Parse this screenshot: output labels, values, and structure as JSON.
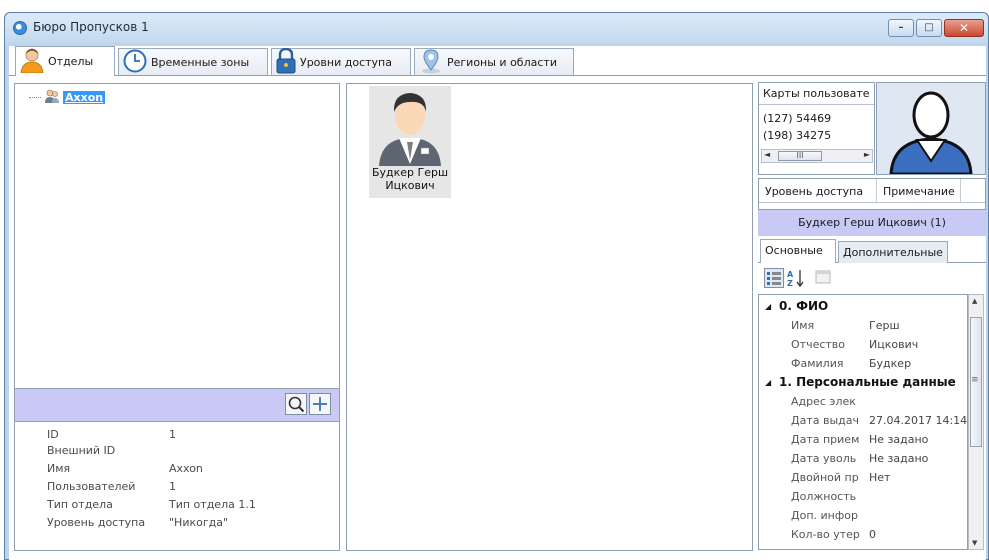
{
  "window": {
    "title": "Бюро Пропусков 1",
    "buttons": {
      "minimize": "–",
      "maximize": "□",
      "close": "✕"
    }
  },
  "tabs": [
    {
      "label": "Отделы",
      "icon": "person-icon",
      "active": true
    },
    {
      "label": "Временные зоны",
      "icon": "clock-icon",
      "active": false
    },
    {
      "label": "Уровни доступа",
      "icon": "lock-icon",
      "active": false
    },
    {
      "label": "Регионы и области",
      "icon": "map-pin-icon",
      "active": false
    }
  ],
  "tree": {
    "root_label": "Axxon"
  },
  "department_props": [
    {
      "key": "ID",
      "value": "1"
    },
    {
      "key": "Внешний ID",
      "value": ""
    },
    {
      "key": "Имя",
      "value": "Axxon"
    },
    {
      "key": "Пользователей",
      "value": "1"
    },
    {
      "key": "Тип отдела",
      "value": "Тип отдела 1.1"
    },
    {
      "key": "Уровень доступа",
      "value": "\"Никогда\""
    }
  ],
  "person_tile": {
    "name_line1": "Будкер Герш",
    "name_line2": "Ицкович"
  },
  "cards": {
    "header": "Карты пользовате",
    "rows": [
      "(127) 54469",
      "(198) 34275"
    ],
    "scroll_label": "III"
  },
  "access_table": {
    "columns": [
      "Уровень доступа",
      "Примечание"
    ]
  },
  "person_header": "Будкер Герш Ицкович (1)",
  "subtabs": [
    {
      "label": "Основные",
      "active": true
    },
    {
      "label": "Дополнительные",
      "active": false
    }
  ],
  "property_grid": [
    {
      "type": "category",
      "label": "0. ФИО"
    },
    {
      "type": "prop",
      "key": "Имя",
      "value": "Герш"
    },
    {
      "type": "prop",
      "key": "Отчество",
      "value": "Ицкович"
    },
    {
      "type": "prop",
      "key": "Фамилия",
      "value": "Будкер"
    },
    {
      "type": "category",
      "label": "1. Персональные данные"
    },
    {
      "type": "prop",
      "key": "Адрес элек",
      "value": ""
    },
    {
      "type": "prop",
      "key": "Дата выдач",
      "value": "27.04.2017 14:14"
    },
    {
      "type": "prop",
      "key": "Дата прием",
      "value": "Не задано"
    },
    {
      "type": "prop",
      "key": "Дата уволь",
      "value": "Не задано"
    },
    {
      "type": "prop",
      "key": "Двойной пр",
      "value": "Нет"
    },
    {
      "type": "prop",
      "key": "Должность",
      "value": ""
    },
    {
      "type": "prop",
      "key": "Доп. инфор",
      "value": ""
    },
    {
      "type": "prop",
      "key": "Кол-во утер",
      "value": "0"
    }
  ],
  "colors": {
    "selection": "#3399ff",
    "panel_lavender": "#c9c9f5",
    "frame": "#bcd4ec"
  }
}
